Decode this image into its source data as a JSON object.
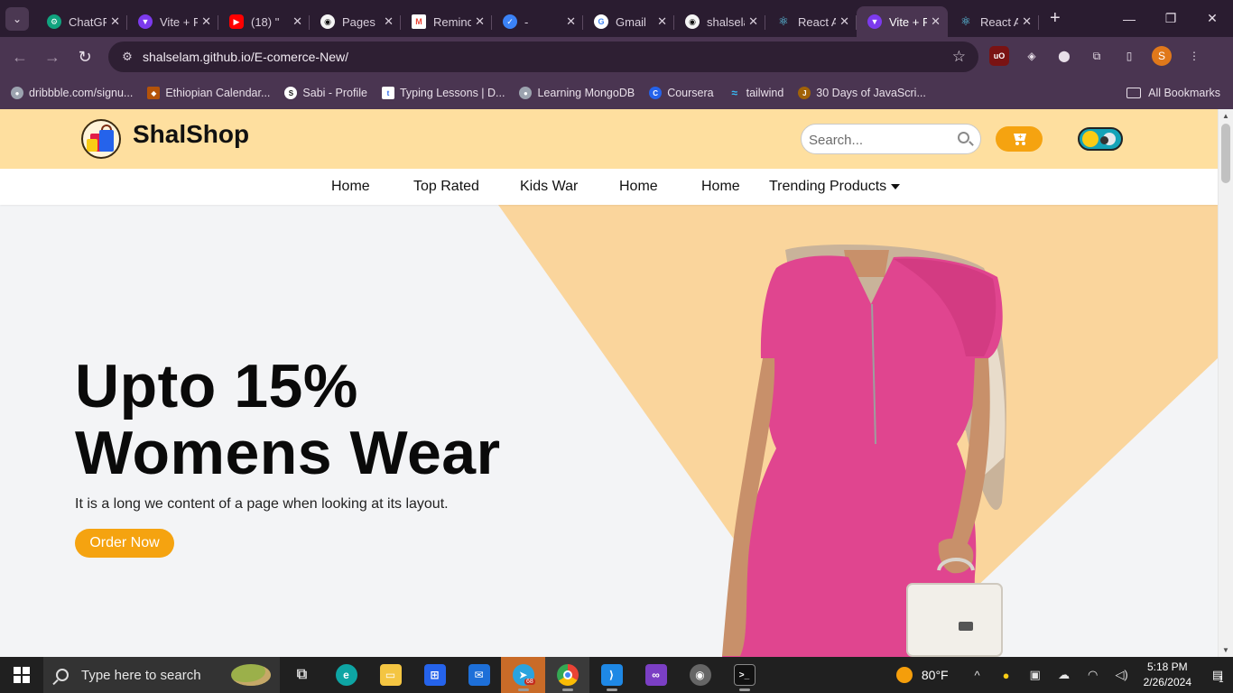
{
  "browser": {
    "tabs": [
      {
        "title": "ChatGPT",
        "favicon": "chatgpt-icon",
        "color": "#10a37f"
      },
      {
        "title": "Vite + React",
        "favicon": "vite-icon",
        "color": "#7c3aed"
      },
      {
        "title": "(18) \"",
        "favicon": "youtube-icon",
        "color": "#ff0000"
      },
      {
        "title": "Pages",
        "favicon": "github-icon",
        "color": "#24292f"
      },
      {
        "title": "Reminders",
        "favicon": "gmail-icon",
        "color": "#ea4335"
      },
      {
        "title": "-",
        "favicon": "check-icon",
        "color": "#3b82f6"
      },
      {
        "title": "Gmail",
        "favicon": "google-icon",
        "color": "#4285f4"
      },
      {
        "title": "shalselam",
        "favicon": "github-icon",
        "color": "#24292f"
      },
      {
        "title": "React App",
        "favicon": "react-icon",
        "color": "#61dafb"
      },
      {
        "title": "Vite + React",
        "favicon": "vite-icon",
        "color": "#7c3aed",
        "active": true
      },
      {
        "title": "React App",
        "favicon": "react-icon",
        "color": "#61dafb"
      }
    ],
    "url": "shalselam.github.io/E-comerce-New/",
    "profile_initial": "S",
    "bookmarks": [
      {
        "label": "dribbble.com/signu...",
        "color": "#6b7280"
      },
      {
        "label": "Ethiopian Calendar...",
        "color": "#b45309"
      },
      {
        "label": "Sabi - Profile",
        "color": "#ffffff"
      },
      {
        "label": "Typing Lessons | D...",
        "color": "#2563eb"
      },
      {
        "label": "Learning MongoDB",
        "color": "#6b7280"
      },
      {
        "label": "Coursera",
        "color": "#2563eb"
      },
      {
        "label": "tailwind",
        "color": "#38bdf8"
      },
      {
        "label": "30 Days of JavaScri...",
        "color": "#a16207"
      }
    ],
    "all_bookmarks": "All Bookmarks"
  },
  "site": {
    "brand": "ShalShop",
    "search_placeholder": "Search...",
    "nav": [
      "Home",
      "Top Rated",
      "Kids War",
      "Home",
      "Home",
      "Trending Products"
    ],
    "hero": {
      "title_line1": "Upto 15%",
      "title_line2": "Womens Wear",
      "subtitle": "It is a long we content of a page when looking at its layout.",
      "cta": "Order Now"
    },
    "colors": {
      "header": "#fedf9f",
      "accent": "#f5a310",
      "hero_bg": "#f3f4f6",
      "triangle": "#fad59c",
      "dress": "#e0458f"
    }
  },
  "taskbar": {
    "search_placeholder": "Type here to search",
    "apps": [
      "task-view-icon",
      "edge-icon",
      "file-explorer-icon",
      "store-icon",
      "mail-icon",
      "telegram-icon",
      "chrome-icon",
      "vscode-icon",
      "visual-studio-icon",
      "github-desktop-icon",
      "terminal-icon"
    ],
    "telegram_badge": "68",
    "weather": "80°F",
    "time": "5:18 PM",
    "date": "2/26/2024",
    "notifications": "1"
  }
}
